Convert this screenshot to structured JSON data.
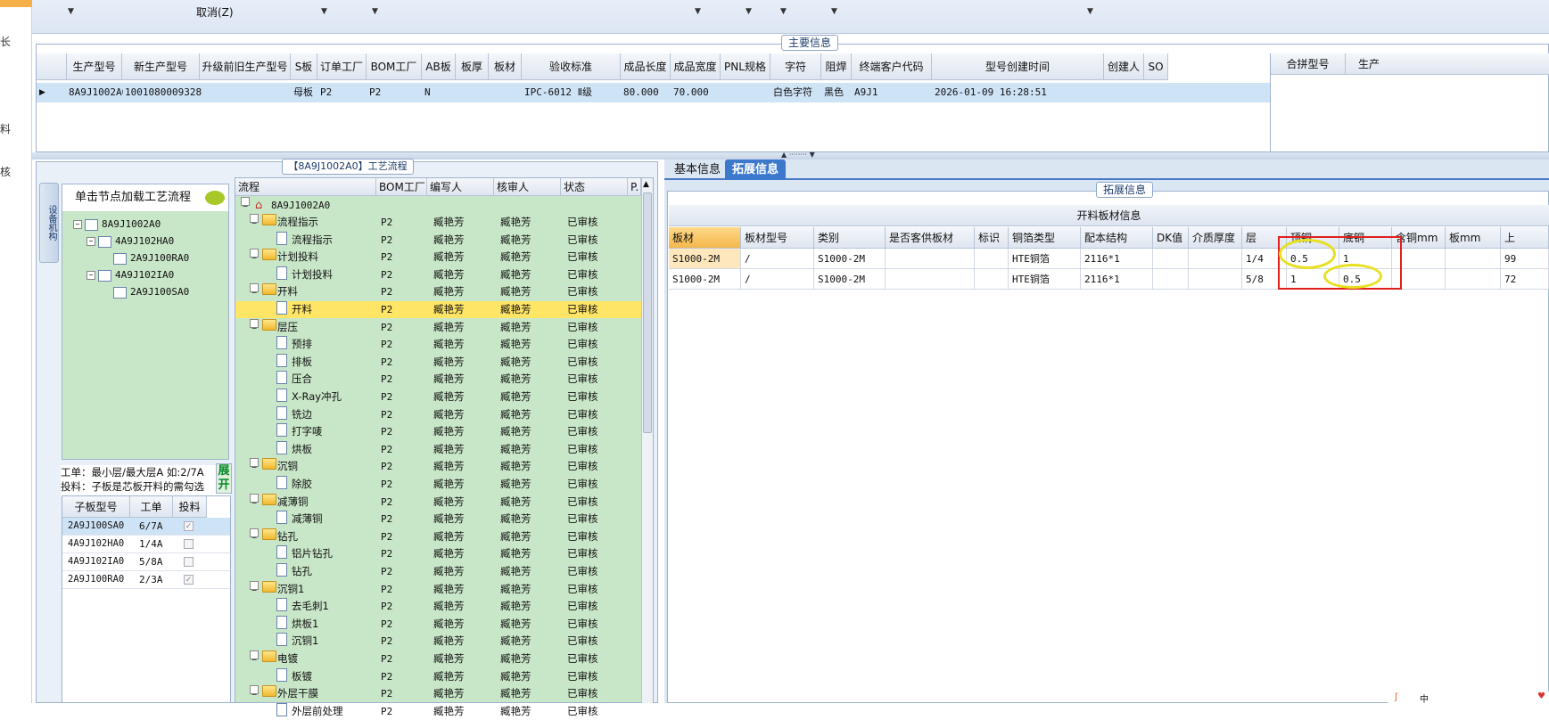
{
  "left_strip": {
    "labels": [
      "长",
      "料",
      "核"
    ]
  },
  "toolbar": {
    "items": [
      "取消(Z)"
    ]
  },
  "main_info": {
    "caption": "主要信息",
    "headers": [
      "生产型号",
      "新生产型号",
      "升级前旧生产型号",
      "S板",
      "订单工厂",
      "BOM工厂",
      "AB板",
      "板厚",
      "板材",
      "验收标准",
      "成品长度",
      "成品宽度",
      "PNL规格",
      "字符",
      "阻焊",
      "终端客户代码",
      "型号创建时间",
      "创建人",
      "SO"
    ],
    "row": [
      "8A9J1002A0",
      "10010800093287",
      "",
      "母板",
      "P2",
      "P2",
      "N",
      "",
      "",
      "IPC-6012 Ⅱ级",
      "80.000",
      "70.000",
      "",
      "白色字符",
      "黑色",
      "A9J1",
      "2026-01-09 16:28:51",
      "",
      ""
    ],
    "right_headers": [
      "合拼型号",
      "生产"
    ]
  },
  "flow_panel": {
    "caption": "【8A9J1002A0】工艺流程",
    "vertical_tab": "设备机构",
    "tree_title": "单击节点加载工艺流程",
    "tree": [
      {
        "label": "8A9J1002A0",
        "level": 0
      },
      {
        "label": "4A9J102HA0",
        "level": 1
      },
      {
        "label": "2A9J100RA0",
        "level": 2
      },
      {
        "label": "4A9J102IA0",
        "level": 1
      },
      {
        "label": "2A9J100SA0",
        "level": 2
      }
    ],
    "hint_line1": "工单：最小层/最大层A 如:2/7A",
    "hint_line2": "投料：子板是芯板开料的需勾选",
    "expand_label": "展开",
    "sub_headers": [
      "子板型号",
      "工单",
      "投料"
    ],
    "sub_rows": [
      {
        "model": "2A9J100SA0",
        "order": "6/7A",
        "checked": true
      },
      {
        "model": "4A9J102HA0",
        "order": "1/4A",
        "checked": false
      },
      {
        "model": "4A9J102IA0",
        "order": "5/8A",
        "checked": false
      },
      {
        "model": "2A9J100RA0",
        "order": "2/3A",
        "checked": true
      }
    ],
    "flow_headers": [
      "流程",
      "BOM工厂",
      "编写人",
      "核审人",
      "状态",
      "P."
    ],
    "flow_root": "8A9J1002A0",
    "flow_rows": [
      {
        "name": "流程指示",
        "type": "folder",
        "factory": "P2",
        "writer": "臧艳芳",
        "reviewer": "臧艳芳",
        "status": "已审核"
      },
      {
        "name": "流程指示",
        "type": "doc",
        "factory": "P2",
        "writer": "臧艳芳",
        "reviewer": "臧艳芳",
        "status": "已审核"
      },
      {
        "name": "计划投料",
        "type": "folder",
        "factory": "P2",
        "writer": "臧艳芳",
        "reviewer": "臧艳芳",
        "status": "已审核"
      },
      {
        "name": "计划投料",
        "type": "doc",
        "factory": "P2",
        "writer": "臧艳芳",
        "reviewer": "臧艳芳",
        "status": "已审核"
      },
      {
        "name": "开料",
        "type": "folder",
        "factory": "P2",
        "writer": "臧艳芳",
        "reviewer": "臧艳芳",
        "status": "已审核"
      },
      {
        "name": "开料",
        "type": "doc",
        "factory": "P2",
        "writer": "臧艳芳",
        "reviewer": "臧艳芳",
        "status": "已审核",
        "selected": true
      },
      {
        "name": "层压",
        "type": "folder",
        "factory": "P2",
        "writer": "臧艳芳",
        "reviewer": "臧艳芳",
        "status": "已审核"
      },
      {
        "name": "预排",
        "type": "doc",
        "factory": "P2",
        "writer": "臧艳芳",
        "reviewer": "臧艳芳",
        "status": "已审核"
      },
      {
        "name": "排板",
        "type": "doc",
        "factory": "P2",
        "writer": "臧艳芳",
        "reviewer": "臧艳芳",
        "status": "已审核"
      },
      {
        "name": "压合",
        "type": "doc",
        "factory": "P2",
        "writer": "臧艳芳",
        "reviewer": "臧艳芳",
        "status": "已审核"
      },
      {
        "name": "X-Ray冲孔",
        "type": "doc",
        "factory": "P2",
        "writer": "臧艳芳",
        "reviewer": "臧艳芳",
        "status": "已审核"
      },
      {
        "name": "铣边",
        "type": "doc",
        "factory": "P2",
        "writer": "臧艳芳",
        "reviewer": "臧艳芳",
        "status": "已审核"
      },
      {
        "name": "打字唛",
        "type": "doc",
        "factory": "P2",
        "writer": "臧艳芳",
        "reviewer": "臧艳芳",
        "status": "已审核"
      },
      {
        "name": "烘板",
        "type": "doc",
        "factory": "P2",
        "writer": "臧艳芳",
        "reviewer": "臧艳芳",
        "status": "已审核"
      },
      {
        "name": "沉铜",
        "type": "folder",
        "factory": "P2",
        "writer": "臧艳芳",
        "reviewer": "臧艳芳",
        "status": "已审核"
      },
      {
        "name": "除胶",
        "type": "doc",
        "factory": "P2",
        "writer": "臧艳芳",
        "reviewer": "臧艳芳",
        "status": "已审核"
      },
      {
        "name": "减薄铜",
        "type": "folder",
        "factory": "P2",
        "writer": "臧艳芳",
        "reviewer": "臧艳芳",
        "status": "已审核"
      },
      {
        "name": "减薄铜",
        "type": "doc",
        "factory": "P2",
        "writer": "臧艳芳",
        "reviewer": "臧艳芳",
        "status": "已审核"
      },
      {
        "name": "钻孔",
        "type": "folder",
        "factory": "P2",
        "writer": "臧艳芳",
        "reviewer": "臧艳芳",
        "status": "已审核"
      },
      {
        "name": "铝片钻孔",
        "type": "doc",
        "factory": "P2",
        "writer": "臧艳芳",
        "reviewer": "臧艳芳",
        "status": "已审核"
      },
      {
        "name": "钻孔",
        "type": "doc",
        "factory": "P2",
        "writer": "臧艳芳",
        "reviewer": "臧艳芳",
        "status": "已审核"
      },
      {
        "name": "沉铜1",
        "type": "folder",
        "factory": "P2",
        "writer": "臧艳芳",
        "reviewer": "臧艳芳",
        "status": "已审核"
      },
      {
        "name": "去毛刺1",
        "type": "doc",
        "factory": "P2",
        "writer": "臧艳芳",
        "reviewer": "臧艳芳",
        "status": "已审核"
      },
      {
        "name": "烘板1",
        "type": "doc",
        "factory": "P2",
        "writer": "臧艳芳",
        "reviewer": "臧艳芳",
        "status": "已审核"
      },
      {
        "name": "沉铜1",
        "type": "doc",
        "factory": "P2",
        "writer": "臧艳芳",
        "reviewer": "臧艳芳",
        "status": "已审核"
      },
      {
        "name": "电镀",
        "type": "folder",
        "factory": "P2",
        "writer": "臧艳芳",
        "reviewer": "臧艳芳",
        "status": "已审核"
      },
      {
        "name": "板镀",
        "type": "doc",
        "factory": "P2",
        "writer": "臧艳芳",
        "reviewer": "臧艳芳",
        "status": "已审核"
      },
      {
        "name": "外层干膜",
        "type": "folder",
        "factory": "P2",
        "writer": "臧艳芳",
        "reviewer": "臧艳芳",
        "status": "已审核"
      },
      {
        "name": "外层前处理",
        "type": "doc",
        "factory": "P2",
        "writer": "臧艳芳",
        "reviewer": "臧艳芳",
        "status": "已审核"
      }
    ]
  },
  "right_panel": {
    "tabs": [
      {
        "label": "基本信息",
        "active": false
      },
      {
        "label": "拓展信息",
        "active": true
      }
    ],
    "caption": "拓展信息",
    "table_title": "开料板材信息",
    "headers": [
      "板材",
      "板材型号",
      "类别",
      "是否客供板材",
      "标识",
      "铜箔类型",
      "配本结构",
      "DK值",
      "介质厚度",
      "层",
      "顶铜",
      "底铜",
      "含铜mm",
      "板mm",
      "上"
    ],
    "rows": [
      [
        "S1000-2M",
        "/",
        "S1000-2M",
        "",
        "",
        "HTE铜箔",
        "2116*1",
        "",
        "",
        "1/4",
        "0.5",
        "1",
        "",
        "",
        "99"
      ],
      [
        "S1000-2M",
        "/",
        "S1000-2M",
        "",
        "",
        "HTE铜箔",
        "2116*1",
        "",
        "",
        "5/8",
        "1",
        "0.5",
        "",
        "",
        "72"
      ]
    ]
  },
  "colors": {
    "accent": "#3c78cc",
    "tree_green": "#c8e6c8",
    "selected_row": "#ffe566",
    "annotation_red": "#e0201c",
    "annotation_yellow": "#e8e020"
  }
}
